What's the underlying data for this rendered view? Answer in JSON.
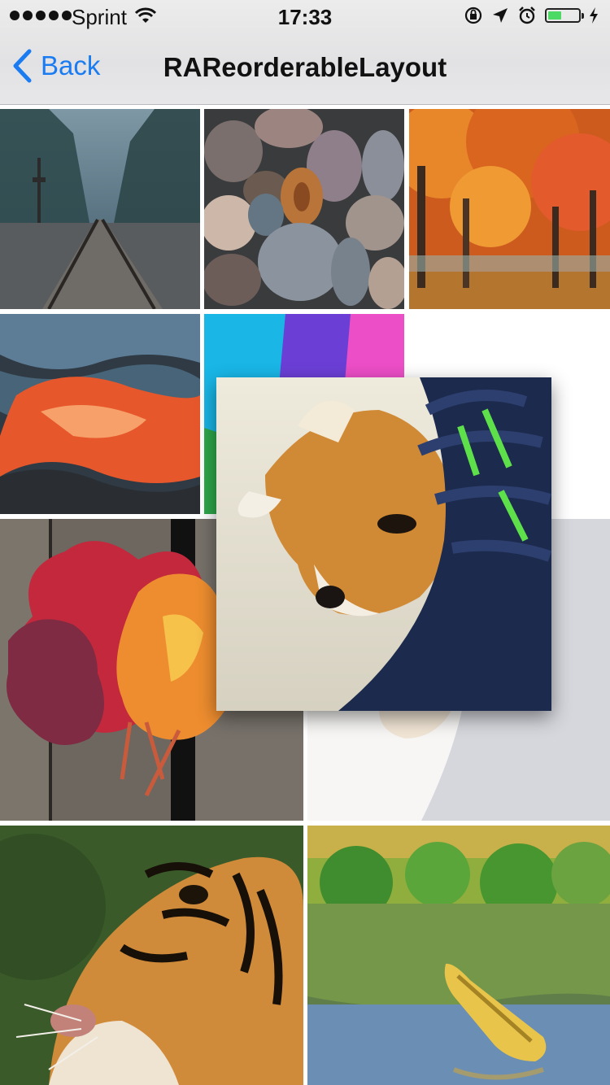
{
  "status_bar": {
    "carrier": "Sprint",
    "time": "17:33",
    "battery_level": 0.5,
    "icons": [
      "signal-dots-icon",
      "wifi-icon",
      "rotation-lock-icon",
      "location-arrow-icon",
      "alarm-icon",
      "battery-icon",
      "charging-bolt-icon"
    ]
  },
  "nav": {
    "back_label": "Back",
    "title": "RAReorderableLayout"
  },
  "grid": {
    "items": [
      {
        "subject": "railroad-tracks-photo"
      },
      {
        "subject": "pebbles-photo"
      },
      {
        "subject": "autumn-trees-photo"
      },
      {
        "subject": "lava-photo"
      },
      {
        "subject": "colorful-shapes-photo"
      },
      {
        "subject": "red-leaves-photo"
      },
      {
        "subject": "dog-and-shoe-photo-placeholder"
      },
      {
        "subject": "tiger-photo"
      },
      {
        "subject": "canoe-lake-photo"
      }
    ],
    "dragging_item": {
      "subject": "dog-and-shoe-photo"
    }
  },
  "colors": {
    "accent": "#1b7cf2",
    "nav_background": "#e6e6e8",
    "battery_fill": "#4cd964"
  }
}
